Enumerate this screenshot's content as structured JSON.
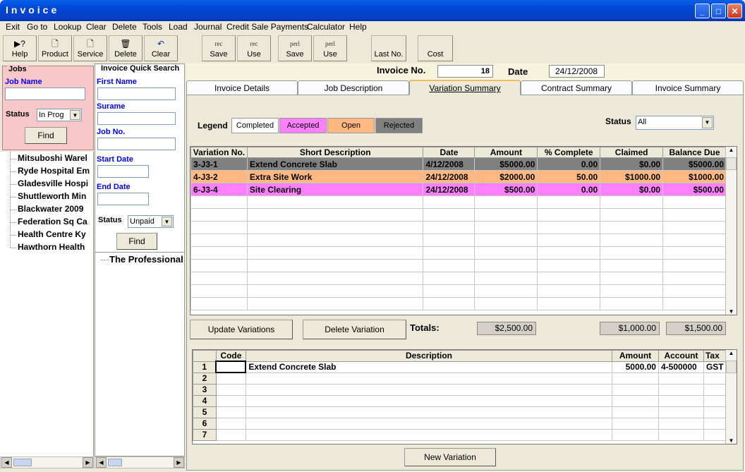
{
  "window": {
    "title": "Invoice"
  },
  "menu": [
    "Exit",
    "Go to",
    "Lookup",
    "Clear",
    "Delete",
    "Tools",
    "Load",
    "Journal",
    "Credit Sale Payments",
    "Calculator",
    "Help"
  ],
  "toolbar": {
    "help": {
      "label": "Help",
      "icon": "help-icon"
    },
    "product": {
      "label": "Product",
      "icon": "document-icon"
    },
    "service": {
      "label": "Service",
      "icon": "magnifier-document-icon"
    },
    "delete": {
      "label": "Delete",
      "icon": "trash-icon"
    },
    "clear": {
      "label": "Clear",
      "icon": "undo-icon"
    },
    "rec_save": {
      "top": "rec",
      "label": "Save"
    },
    "rec_use": {
      "top": "rec",
      "label": "Use"
    },
    "perl_save": {
      "top": "perl",
      "label": "Save"
    },
    "perl_use": {
      "top": "perl",
      "label": "Use"
    },
    "last_no": {
      "label": "Last No."
    },
    "cost": {
      "label": "Cost"
    }
  },
  "jobs": {
    "title": "Jobs",
    "job_name_label": "Job Name",
    "status_label": "Status",
    "status_value": "In Prog",
    "find_label": "Find",
    "tree": [
      "Mitsuboshi Warel",
      "Ryde Hospital Em",
      "Gladesville Hospi",
      "Shuttleworth Min",
      "Blackwater 2009",
      "Federation Sq Ca",
      "Health Centre Ky",
      "Hawthorn Health"
    ]
  },
  "quick_search": {
    "title": "Invoice Quick Search",
    "first_name_label": "First Name",
    "surname_label": "Surame",
    "job_no_label": "Job No.",
    "start_date_label": "Start Date",
    "end_date_label": "End Date",
    "status_label": "Status",
    "status_value": "Unpaid",
    "find_label": "Find",
    "tree": [
      "The Professional"
    ]
  },
  "header": {
    "invoice_no_label": "Invoice No.",
    "invoice_no": "18",
    "date_label": "Date",
    "date": "24/12/2008"
  },
  "tabs": [
    "Invoice Details",
    "Job Description",
    "Variation Summary",
    "Contract Summary",
    "Invoice Summary"
  ],
  "legend": {
    "label": "Legend",
    "items": [
      {
        "label": "Completed",
        "color": "#ffffff"
      },
      {
        "label": "Accepted",
        "color": "#ff80ff"
      },
      {
        "label": "Open",
        "color": "#ffb980"
      },
      {
        "label": "Rejected",
        "color": "#808080"
      }
    ]
  },
  "status_filter": {
    "label": "Status",
    "value": "All"
  },
  "variations": {
    "columns": [
      "Variation No.",
      "Short Description",
      "Date",
      "Amount",
      "% Complete",
      "Claimed",
      "Balance Due"
    ],
    "rows": [
      {
        "cells": [
          "3-J3-1",
          "Extend Concrete Slab",
          "4/12/2008",
          "$5000.00",
          "0.00",
          "$0.00",
          "$5000.00"
        ],
        "color": "#808080"
      },
      {
        "cells": [
          "4-J3-2",
          "Extra Site Work",
          "24/12/2008",
          "$2000.00",
          "50.00",
          "$1000.00",
          "$1000.00"
        ],
        "color": "#ffb980"
      },
      {
        "cells": [
          "6-J3-4",
          "Site Clearing",
          "24/12/2008",
          "$500.00",
          "0.00",
          "$0.00",
          "$500.00"
        ],
        "color": "#ff80ff"
      }
    ]
  },
  "actions": {
    "update": "Update Variations",
    "delete": "Delete Variation",
    "new": "New Variation"
  },
  "totals": {
    "label": "Totals:",
    "amount": "$2,500.00",
    "claimed": "$1,000.00",
    "balance": "$1,500.00"
  },
  "items": {
    "columns": [
      "Code",
      "Description",
      "Amount",
      "Account",
      "Tax"
    ],
    "rows": [
      {
        "no": "1",
        "code": "",
        "description": "Extend Concrete Slab",
        "amount": "5000.00",
        "account": "4-500000",
        "tax": "GST"
      },
      {
        "no": "2"
      },
      {
        "no": "3"
      },
      {
        "no": "4"
      },
      {
        "no": "5"
      },
      {
        "no": "6"
      },
      {
        "no": "7"
      }
    ]
  }
}
